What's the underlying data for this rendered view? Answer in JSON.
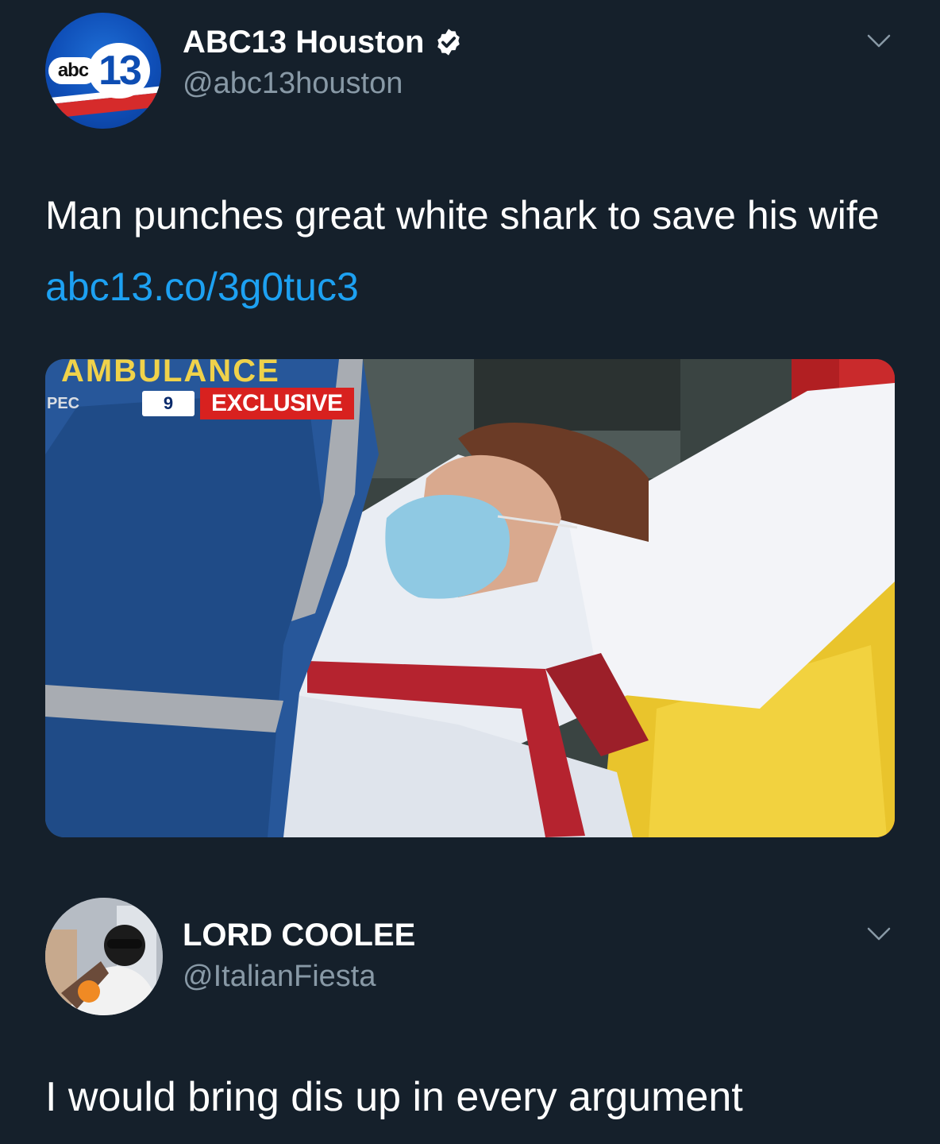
{
  "tweet": {
    "avatar": {
      "icon": "abc13-logo",
      "abc": "abc",
      "number": "13"
    },
    "display_name": "ABC13 Houston",
    "verified_icon": "verified-badge-icon",
    "handle": "@abc13houston",
    "text": "Man punches great white shark to save his wife",
    "link": "abc13.co/3g0tuc3",
    "media": {
      "channel_logo": "9",
      "badge": "EXCLUSIVE",
      "background_text": "AMBULANCE"
    }
  },
  "reply": {
    "display_name": "LORD COOLEE",
    "handle": "@ItalianFiesta",
    "text": "I would bring dis up in every argument"
  },
  "colors": {
    "background": "#15202b",
    "link": "#1da1f2",
    "secondary_text": "#8899a6",
    "badge_red": "#d8211f"
  }
}
